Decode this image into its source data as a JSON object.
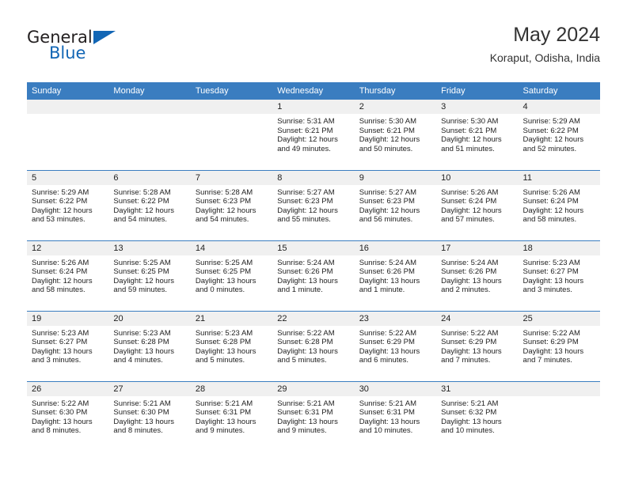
{
  "brand": {
    "name_part1": "General",
    "name_part2": "Blue",
    "accent_color": "#1266b5"
  },
  "header": {
    "title": "May 2024",
    "subtitle": "Koraput, Odisha, India"
  },
  "theme": {
    "header_row_color": "#3a7dc0",
    "daynum_band_color": "#f0f0f0",
    "text_color": "#222222"
  },
  "weekdays": [
    "Sunday",
    "Monday",
    "Tuesday",
    "Wednesday",
    "Thursday",
    "Friday",
    "Saturday"
  ],
  "weeks": [
    [
      {
        "day": "",
        "sunrise": "",
        "sunset": "",
        "daylight_line1": "",
        "daylight_line2": "",
        "empty": true
      },
      {
        "day": "",
        "sunrise": "",
        "sunset": "",
        "daylight_line1": "",
        "daylight_line2": "",
        "empty": true
      },
      {
        "day": "",
        "sunrise": "",
        "sunset": "",
        "daylight_line1": "",
        "daylight_line2": "",
        "empty": true
      },
      {
        "day": "1",
        "sunrise": "Sunrise: 5:31 AM",
        "sunset": "Sunset: 6:21 PM",
        "daylight_line1": "Daylight: 12 hours",
        "daylight_line2": "and 49 minutes."
      },
      {
        "day": "2",
        "sunrise": "Sunrise: 5:30 AM",
        "sunset": "Sunset: 6:21 PM",
        "daylight_line1": "Daylight: 12 hours",
        "daylight_line2": "and 50 minutes."
      },
      {
        "day": "3",
        "sunrise": "Sunrise: 5:30 AM",
        "sunset": "Sunset: 6:21 PM",
        "daylight_line1": "Daylight: 12 hours",
        "daylight_line2": "and 51 minutes."
      },
      {
        "day": "4",
        "sunrise": "Sunrise: 5:29 AM",
        "sunset": "Sunset: 6:22 PM",
        "daylight_line1": "Daylight: 12 hours",
        "daylight_line2": "and 52 minutes."
      }
    ],
    [
      {
        "day": "5",
        "sunrise": "Sunrise: 5:29 AM",
        "sunset": "Sunset: 6:22 PM",
        "daylight_line1": "Daylight: 12 hours",
        "daylight_line2": "and 53 minutes."
      },
      {
        "day": "6",
        "sunrise": "Sunrise: 5:28 AM",
        "sunset": "Sunset: 6:22 PM",
        "daylight_line1": "Daylight: 12 hours",
        "daylight_line2": "and 54 minutes."
      },
      {
        "day": "7",
        "sunrise": "Sunrise: 5:28 AM",
        "sunset": "Sunset: 6:23 PM",
        "daylight_line1": "Daylight: 12 hours",
        "daylight_line2": "and 54 minutes."
      },
      {
        "day": "8",
        "sunrise": "Sunrise: 5:27 AM",
        "sunset": "Sunset: 6:23 PM",
        "daylight_line1": "Daylight: 12 hours",
        "daylight_line2": "and 55 minutes."
      },
      {
        "day": "9",
        "sunrise": "Sunrise: 5:27 AM",
        "sunset": "Sunset: 6:23 PM",
        "daylight_line1": "Daylight: 12 hours",
        "daylight_line2": "and 56 minutes."
      },
      {
        "day": "10",
        "sunrise": "Sunrise: 5:26 AM",
        "sunset": "Sunset: 6:24 PM",
        "daylight_line1": "Daylight: 12 hours",
        "daylight_line2": "and 57 minutes."
      },
      {
        "day": "11",
        "sunrise": "Sunrise: 5:26 AM",
        "sunset": "Sunset: 6:24 PM",
        "daylight_line1": "Daylight: 12 hours",
        "daylight_line2": "and 58 minutes."
      }
    ],
    [
      {
        "day": "12",
        "sunrise": "Sunrise: 5:26 AM",
        "sunset": "Sunset: 6:24 PM",
        "daylight_line1": "Daylight: 12 hours",
        "daylight_line2": "and 58 minutes."
      },
      {
        "day": "13",
        "sunrise": "Sunrise: 5:25 AM",
        "sunset": "Sunset: 6:25 PM",
        "daylight_line1": "Daylight: 12 hours",
        "daylight_line2": "and 59 minutes."
      },
      {
        "day": "14",
        "sunrise": "Sunrise: 5:25 AM",
        "sunset": "Sunset: 6:25 PM",
        "daylight_line1": "Daylight: 13 hours",
        "daylight_line2": "and 0 minutes."
      },
      {
        "day": "15",
        "sunrise": "Sunrise: 5:24 AM",
        "sunset": "Sunset: 6:26 PM",
        "daylight_line1": "Daylight: 13 hours",
        "daylight_line2": "and 1 minute."
      },
      {
        "day": "16",
        "sunrise": "Sunrise: 5:24 AM",
        "sunset": "Sunset: 6:26 PM",
        "daylight_line1": "Daylight: 13 hours",
        "daylight_line2": "and 1 minute."
      },
      {
        "day": "17",
        "sunrise": "Sunrise: 5:24 AM",
        "sunset": "Sunset: 6:26 PM",
        "daylight_line1": "Daylight: 13 hours",
        "daylight_line2": "and 2 minutes."
      },
      {
        "day": "18",
        "sunrise": "Sunrise: 5:23 AM",
        "sunset": "Sunset: 6:27 PM",
        "daylight_line1": "Daylight: 13 hours",
        "daylight_line2": "and 3 minutes."
      }
    ],
    [
      {
        "day": "19",
        "sunrise": "Sunrise: 5:23 AM",
        "sunset": "Sunset: 6:27 PM",
        "daylight_line1": "Daylight: 13 hours",
        "daylight_line2": "and 3 minutes."
      },
      {
        "day": "20",
        "sunrise": "Sunrise: 5:23 AM",
        "sunset": "Sunset: 6:28 PM",
        "daylight_line1": "Daylight: 13 hours",
        "daylight_line2": "and 4 minutes."
      },
      {
        "day": "21",
        "sunrise": "Sunrise: 5:23 AM",
        "sunset": "Sunset: 6:28 PM",
        "daylight_line1": "Daylight: 13 hours",
        "daylight_line2": "and 5 minutes."
      },
      {
        "day": "22",
        "sunrise": "Sunrise: 5:22 AM",
        "sunset": "Sunset: 6:28 PM",
        "daylight_line1": "Daylight: 13 hours",
        "daylight_line2": "and 5 minutes."
      },
      {
        "day": "23",
        "sunrise": "Sunrise: 5:22 AM",
        "sunset": "Sunset: 6:29 PM",
        "daylight_line1": "Daylight: 13 hours",
        "daylight_line2": "and 6 minutes."
      },
      {
        "day": "24",
        "sunrise": "Sunrise: 5:22 AM",
        "sunset": "Sunset: 6:29 PM",
        "daylight_line1": "Daylight: 13 hours",
        "daylight_line2": "and 7 minutes."
      },
      {
        "day": "25",
        "sunrise": "Sunrise: 5:22 AM",
        "sunset": "Sunset: 6:29 PM",
        "daylight_line1": "Daylight: 13 hours",
        "daylight_line2": "and 7 minutes."
      }
    ],
    [
      {
        "day": "26",
        "sunrise": "Sunrise: 5:22 AM",
        "sunset": "Sunset: 6:30 PM",
        "daylight_line1": "Daylight: 13 hours",
        "daylight_line2": "and 8 minutes."
      },
      {
        "day": "27",
        "sunrise": "Sunrise: 5:21 AM",
        "sunset": "Sunset: 6:30 PM",
        "daylight_line1": "Daylight: 13 hours",
        "daylight_line2": "and 8 minutes."
      },
      {
        "day": "28",
        "sunrise": "Sunrise: 5:21 AM",
        "sunset": "Sunset: 6:31 PM",
        "daylight_line1": "Daylight: 13 hours",
        "daylight_line2": "and 9 minutes."
      },
      {
        "day": "29",
        "sunrise": "Sunrise: 5:21 AM",
        "sunset": "Sunset: 6:31 PM",
        "daylight_line1": "Daylight: 13 hours",
        "daylight_line2": "and 9 minutes."
      },
      {
        "day": "30",
        "sunrise": "Sunrise: 5:21 AM",
        "sunset": "Sunset: 6:31 PM",
        "daylight_line1": "Daylight: 13 hours",
        "daylight_line2": "and 10 minutes."
      },
      {
        "day": "31",
        "sunrise": "Sunrise: 5:21 AM",
        "sunset": "Sunset: 6:32 PM",
        "daylight_line1": "Daylight: 13 hours",
        "daylight_line2": "and 10 minutes."
      },
      {
        "day": "",
        "sunrise": "",
        "sunset": "",
        "daylight_line1": "",
        "daylight_line2": "",
        "empty": true
      }
    ]
  ]
}
